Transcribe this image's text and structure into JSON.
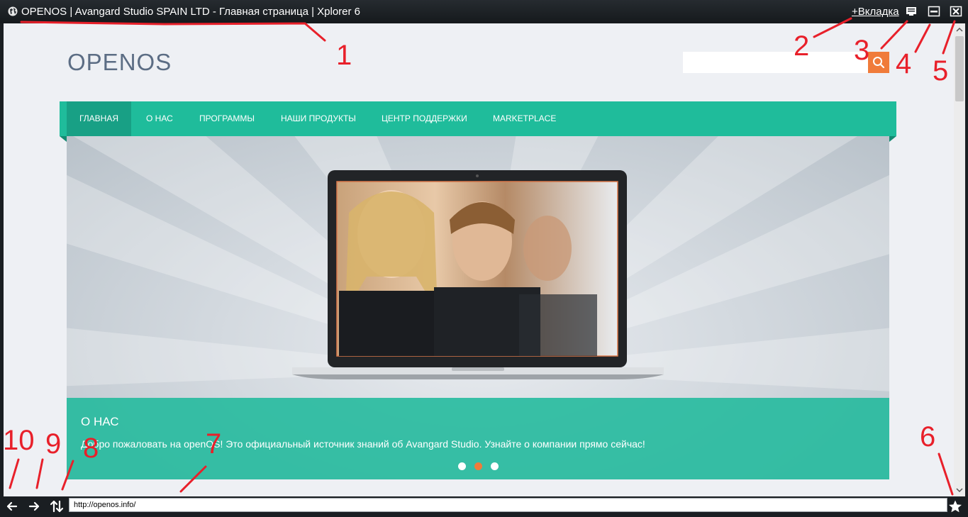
{
  "window": {
    "title": "OPENOS | Avangard Studio SPAIN LTD - Главная страница | Xplorer 6",
    "new_tab_label": "+Вкладка",
    "icons": [
      "globe-icon",
      "screen-icon",
      "minimize-icon",
      "close-icon"
    ]
  },
  "page": {
    "logo": "OPENOS",
    "search": {
      "value": "",
      "placeholder": ""
    },
    "nav": [
      {
        "label": "ГЛАВНАЯ",
        "active": true
      },
      {
        "label": "О НАС",
        "active": false
      },
      {
        "label": "ПРОГРАММЫ",
        "active": false
      },
      {
        "label": "НАШИ ПРОДУКТЫ",
        "active": false
      },
      {
        "label": "ЦЕНТР ПОДДЕРЖКИ",
        "active": false
      },
      {
        "label": "MARKETPLACE",
        "active": false
      }
    ],
    "slider": {
      "caption_title": "О НАС",
      "caption_text": "Добро пожаловать на openOS! Это официальный источник знаний об Avangard Studio. Узнайте о компании прямо сейчас!",
      "slide_count": 3,
      "active_slide": 2
    }
  },
  "bottom": {
    "url": "http://openos.info/",
    "icons": [
      "back-arrow-icon",
      "forward-arrow-icon",
      "sort-arrows-icon",
      "star-icon"
    ]
  },
  "annotations": [
    "1",
    "2",
    "3",
    "4",
    "5",
    "6",
    "7",
    "8",
    "9",
    "10"
  ],
  "colors": {
    "accent_teal": "#1fbc9b",
    "accent_orange": "#f07b3a",
    "annotation_red": "#e8202a",
    "chrome_dark": "#1a1e22"
  }
}
